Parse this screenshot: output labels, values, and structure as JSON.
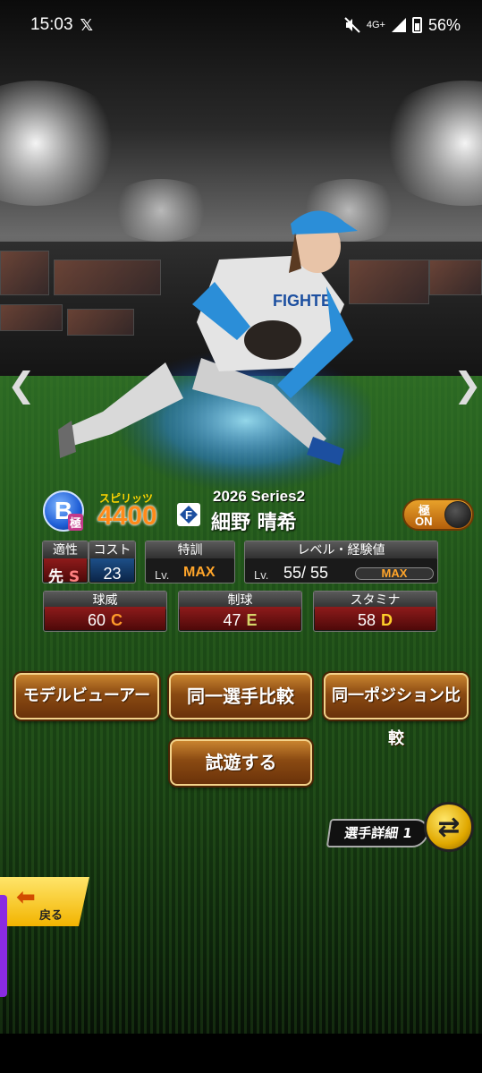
{
  "status_bar": {
    "time": "15:03",
    "x_app": "𝕏",
    "network": "4G+",
    "battery": "56%"
  },
  "card": {
    "rank_letter": "B",
    "rank_sub": "極",
    "spirit_label": "スピリッツ",
    "spirit_value": "4400",
    "team_logo_letter": "F",
    "series": "2026 Series2",
    "player_name": "細野 晴希",
    "kiwame_toggle": {
      "label": "極",
      "state": "ON"
    }
  },
  "stats": {
    "aptitude": {
      "header": "適性",
      "position": "先",
      "grade": "S"
    },
    "cost": {
      "header": "コスト",
      "value": "23"
    },
    "training": {
      "header": "特訓",
      "lv_prefix": "Lv.",
      "value": "MAX"
    },
    "level": {
      "header": "レベル・経験値",
      "lv_prefix": "Lv.",
      "value": "55/ 55",
      "exp_label": "MAX"
    }
  },
  "abilities": [
    {
      "header": "球威",
      "value": "60",
      "grade": "C",
      "grade_color": "#ff9a2a"
    },
    {
      "header": "制球",
      "value": "47",
      "grade": "E",
      "grade_color": "#d6d66a"
    },
    {
      "header": "スタミナ",
      "value": "58",
      "grade": "D",
      "grade_color": "#ffd02a"
    }
  ],
  "buttons": {
    "model_viewer": "モデルビューアー",
    "same_player_compare": "同一選手比較",
    "same_position_compare": "同一ポジション比較",
    "trial": "試遊する",
    "player_detail": "選手詳細 1",
    "back": "戻る"
  }
}
